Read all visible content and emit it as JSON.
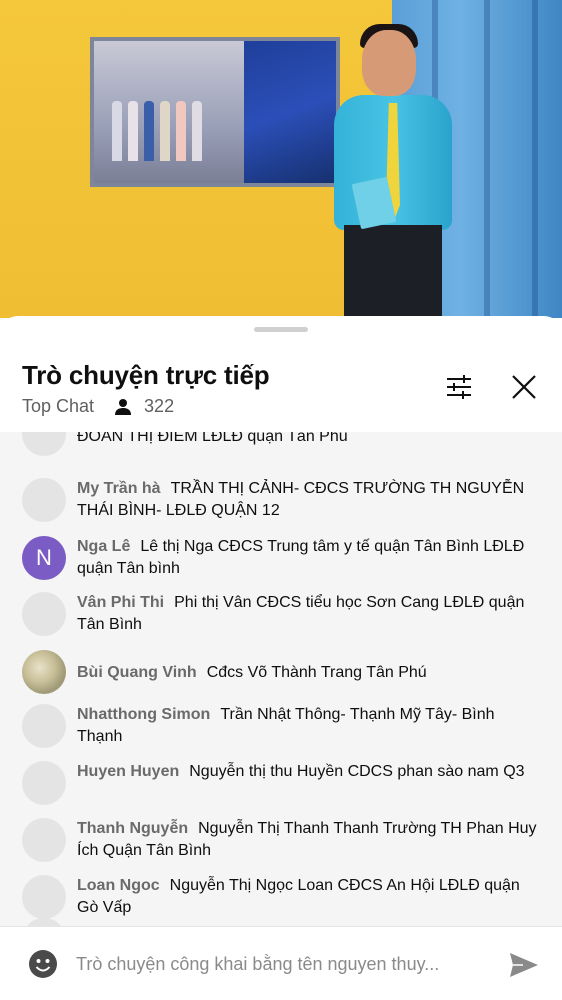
{
  "chat_panel": {
    "title": "Trò chuyện trực tiếp",
    "mode": "Top Chat",
    "viewer_count": "322"
  },
  "messages": [
    {
      "author": "",
      "text": "ĐOAN THỊ ĐIEM LĐLĐ quận Tân Phú",
      "avatar": "blank"
    },
    {
      "author": "My Trần hà",
      "text": "TRẦN THỊ CẢNH- CĐCS TRƯỜNG TH NGUYỄN THÁI BÌNH- LĐLĐ QUẬN 12",
      "avatar": "blank"
    },
    {
      "author": "Nga Lê",
      "text": "Lê thị Nga CĐCS Trung tâm y tế quận Tân Bình LĐLĐ quận Tân bình",
      "avatar": "letter",
      "avatar_letter": "N"
    },
    {
      "author": "Vân Phi Thi",
      "text": "Phi thị Vân CĐCS tiểu học Sơn Cang LĐLĐ quận Tân Bình",
      "avatar": "blank"
    },
    {
      "author": "Bùi Quang Vinh",
      "text": "Cđcs Võ Thành Trang Tân Phú",
      "avatar": "photo"
    },
    {
      "author": "Nhatthong Simon",
      "text": "Trần Nhật Thông- Thạnh Mỹ Tây- Bình Thạnh",
      "avatar": "blank"
    },
    {
      "author": "Huyen Huyen",
      "text": "Nguyễn thị thu Huyền CDCS phan sào nam Q3",
      "avatar": "blank"
    },
    {
      "author": "Thanh Nguyễn",
      "text": "Nguyễn Thị Thanh Thanh Trường TH Phan Huy Ích Quận Tân Bình",
      "avatar": "blank"
    },
    {
      "author": "Loan Ngoc",
      "text": "Nguyễn Thị Ngọc Loan CĐCS An Hội LĐLĐ quận Gò Vấp",
      "avatar": "blank"
    }
  ],
  "composer": {
    "placeholder": "Trò chuyện công khai bằng tên nguyen thuy..."
  },
  "icons": {
    "viewers": "person-icon",
    "filter": "sliders-icon",
    "close": "close-icon",
    "emoji": "emoji-icon",
    "send": "send-icon"
  },
  "colors": {
    "letter_avatar": "#7b5cc4",
    "author_text": "#6a6a6a"
  }
}
